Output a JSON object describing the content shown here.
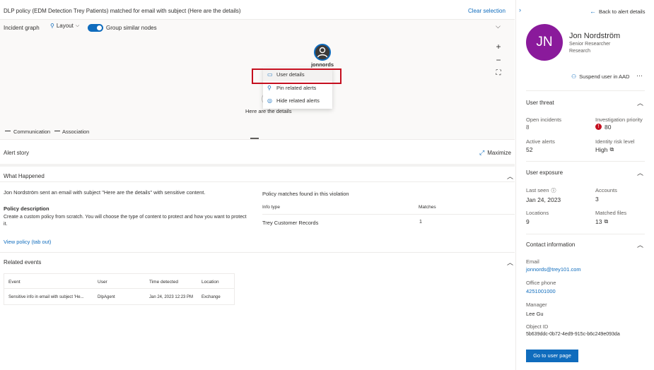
{
  "header": {
    "title": "DLP policy (EDM Detection Trey Patients) matched for email with subject (Here are the details)",
    "clear_selection": "Clear selection"
  },
  "graph_toolbar": {
    "incident_graph": "Incident graph",
    "layout": "Layout",
    "group_similar_nodes": "Group similar nodes"
  },
  "graph": {
    "user_node_label": "jonnords",
    "email_node_label": "Here are the details",
    "legend_communication": "Communication",
    "legend_association": "Association",
    "context_menu": [
      {
        "label": "User details",
        "icon": "user-card-icon"
      },
      {
        "label": "Pin related alerts",
        "icon": "pin-icon"
      },
      {
        "label": "Hide related alerts",
        "icon": "eye-hide-icon"
      }
    ]
  },
  "alert_story": {
    "title": "Alert story",
    "maximize": "Maximize"
  },
  "what_happened": {
    "title": "What Happened",
    "text": "Jon Nordström sent an email with subject \"Here are the details\" with sensitive content.",
    "policy_description_title": "Policy description",
    "policy_description_text": "Create a custom policy from scratch. You will choose the type of content to protect and how you want to protect it.",
    "view_policy": "View policy (tab out)",
    "policy_matches_title": "Policy matches found in this violation",
    "policy_matches_headers": [
      "Info type",
      "Matches"
    ],
    "policy_matches_rows": [
      [
        "Trey Customer Records",
        "1"
      ]
    ]
  },
  "related_events": {
    "title": "Related events",
    "headers": [
      "Event",
      "User",
      "Time detected",
      "Location"
    ],
    "rows": [
      [
        "Sensitive info in email with subject 'He...",
        "DlpAgent",
        "Jan 24, 2023 12:23 PM",
        "Exchange"
      ]
    ]
  },
  "right_panel": {
    "back_to_alert": "Back to alert details",
    "avatar_initials": "JN",
    "name": "Jon Nordström",
    "role": "Senior Researcher",
    "department": "Research",
    "suspend_user": "Suspend user in AAD",
    "user_threat": {
      "title": "User threat",
      "open_incidents_label": "Open incidents",
      "open_incidents_value": "8",
      "investigation_priority_label": "Investigation priority",
      "investigation_priority_value": "80",
      "active_alerts_label": "Active alerts",
      "active_alerts_value": "52",
      "identity_risk_label": "Identity risk level",
      "identity_risk_value": "High"
    },
    "user_exposure": {
      "title": "User exposure",
      "last_seen_label": "Last seen",
      "last_seen_value": "Jan 24, 2023",
      "accounts_label": "Accounts",
      "accounts_value": "3",
      "locations_label": "Locations",
      "locations_value": "9",
      "matched_files_label": "Matched files",
      "matched_files_value": "13"
    },
    "contact": {
      "title": "Contact information",
      "email_label": "Email",
      "email_value": "jonnords@trey101.com",
      "phone_label": "Office phone",
      "phone_value": "4251001000",
      "manager_label": "Manager",
      "manager_value": "Lee Gu",
      "object_id_label": "Object ID",
      "object_id_value": "5b639ddc-0b72-4ed9-915c-b6c249e093da"
    },
    "go_to_user_page": "Go to user page"
  },
  "colors": {
    "accent": "#0f6cbd",
    "avatar": "#8a1a9b",
    "highlight_box": "#c50f1f",
    "priority_badge": "#c50f1f"
  }
}
